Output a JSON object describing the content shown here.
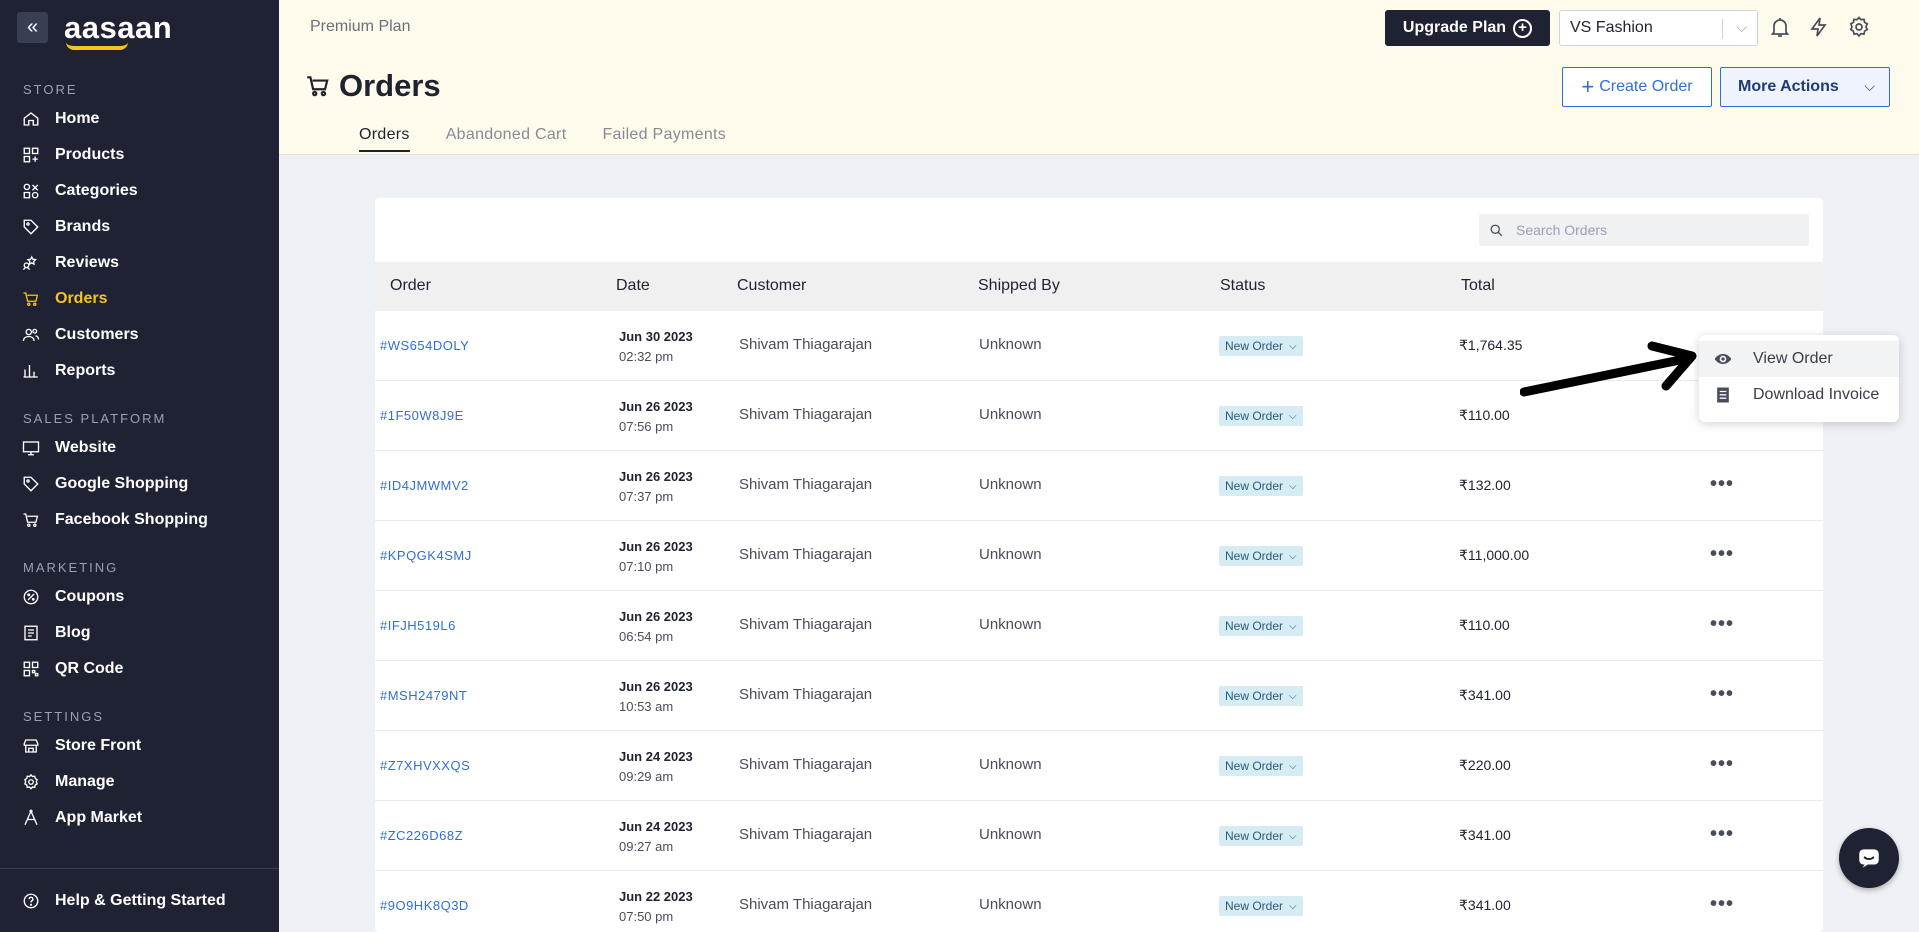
{
  "sidebar": {
    "logo": "aasaan",
    "sections": [
      {
        "title": "STORE",
        "items": [
          {
            "label": "Home",
            "icon": "home-icon"
          },
          {
            "label": "Products",
            "icon": "products-icon"
          },
          {
            "label": "Categories",
            "icon": "categories-icon"
          },
          {
            "label": "Brands",
            "icon": "tag-icon"
          },
          {
            "label": "Reviews",
            "icon": "reviews-icon"
          },
          {
            "label": "Orders",
            "icon": "cart-icon",
            "active": true
          },
          {
            "label": "Customers",
            "icon": "users-icon"
          },
          {
            "label": "Reports",
            "icon": "bar-chart-icon"
          }
        ]
      },
      {
        "title": "SALES PLATFORM",
        "items": [
          {
            "label": "Website",
            "icon": "monitor-icon"
          },
          {
            "label": "Google Shopping",
            "icon": "tag-icon"
          },
          {
            "label": "Facebook Shopping",
            "icon": "cart-icon"
          }
        ]
      },
      {
        "title": "MARKETING",
        "items": [
          {
            "label": "Coupons",
            "icon": "coupon-icon"
          },
          {
            "label": "Blog",
            "icon": "blog-icon"
          },
          {
            "label": "QR Code",
            "icon": "qr-icon"
          }
        ]
      },
      {
        "title": "SETTINGS",
        "items": [
          {
            "label": "Store Front",
            "icon": "storefront-icon"
          },
          {
            "label": "Manage",
            "icon": "gear-icon"
          },
          {
            "label": "App Market",
            "icon": "app-market-icon"
          }
        ]
      }
    ],
    "footer": "Help & Getting Started"
  },
  "header": {
    "plan": "Premium Plan",
    "upgrade_label": "Upgrade Plan",
    "store": "VS Fashion",
    "title": "Orders",
    "create_label": "Create Order",
    "more_label": "More Actions",
    "tabs": [
      "Orders",
      "Abandoned Cart",
      "Failed Payments"
    ]
  },
  "search": {
    "placeholder": "Search Orders"
  },
  "table": {
    "columns": [
      "Order",
      "Date",
      "Customer",
      "Shipped By",
      "Status",
      "Total"
    ],
    "rows": [
      {
        "id": "#WS654DOLY",
        "date": "Jun 30 2023",
        "time": "02:32 pm",
        "customer": "Shivam Thiagarajan",
        "shipped": "Unknown",
        "status": "New Order",
        "total": "₹1,764.35"
      },
      {
        "id": "#1F50W8J9E",
        "date": "Jun 26 2023",
        "time": "07:56 pm",
        "customer": "Shivam Thiagarajan",
        "shipped": "Unknown",
        "status": "New Order",
        "total": "₹110.00"
      },
      {
        "id": "#ID4JMWMV2",
        "date": "Jun 26 2023",
        "time": "07:37 pm",
        "customer": "Shivam Thiagarajan",
        "shipped": "Unknown",
        "status": "New Order",
        "total": "₹132.00"
      },
      {
        "id": "#KPQGK4SMJ",
        "date": "Jun 26 2023",
        "time": "07:10 pm",
        "customer": "Shivam Thiagarajan",
        "shipped": "Unknown",
        "status": "New Order",
        "total": "₹11,000.00"
      },
      {
        "id": "#IFJH519L6",
        "date": "Jun 26 2023",
        "time": "06:54 pm",
        "customer": "Shivam Thiagarajan",
        "shipped": "Unknown",
        "status": "New Order",
        "total": "₹110.00"
      },
      {
        "id": "#MSH2479NT",
        "date": "Jun 26 2023",
        "time": "10:53 am",
        "customer": "Shivam Thiagarajan",
        "shipped": "",
        "status": "New Order",
        "total": "₹341.00"
      },
      {
        "id": "#Z7XHVXXQS",
        "date": "Jun 24 2023",
        "time": "09:29 am",
        "customer": "Shivam Thiagarajan",
        "shipped": "Unknown",
        "status": "New Order",
        "total": "₹220.00"
      },
      {
        "id": "#ZC226D68Z",
        "date": "Jun 24 2023",
        "time": "09:27 am",
        "customer": "Shivam Thiagarajan",
        "shipped": "Unknown",
        "status": "New Order",
        "total": "₹341.00"
      },
      {
        "id": "#9O9HK8Q3D",
        "date": "Jun 22 2023",
        "time": "07:50 pm",
        "customer": "Shivam Thiagarajan",
        "shipped": "Unknown",
        "status": "New Order",
        "total": "₹341.00"
      }
    ]
  },
  "menu": {
    "view_label": "View Order",
    "invoice_label": "Download Invoice"
  },
  "colors": {
    "sidebar_bg": "#1f2233",
    "accent": "#f6c31c",
    "link": "#2f6fd8",
    "header_bg": "#fffbec"
  }
}
